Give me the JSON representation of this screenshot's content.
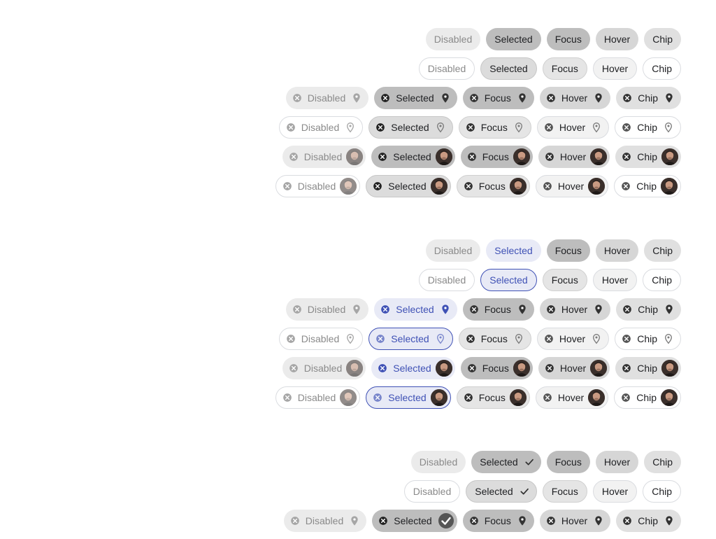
{
  "sections": [
    {
      "scheme": "default",
      "rows": [
        {
          "variant": "filled",
          "lead": false,
          "trail": "none",
          "chips": [
            {
              "state": "disabled",
              "label": "Disabled"
            },
            {
              "state": "selected",
              "label": "Selected"
            },
            {
              "state": "focus",
              "label": "Focus"
            },
            {
              "state": "hover",
              "label": "Hover"
            },
            {
              "state": "normal",
              "label": "Chip"
            }
          ]
        },
        {
          "variant": "outlined",
          "lead": false,
          "trail": "none",
          "chips": [
            {
              "state": "disabled",
              "label": "Disabled"
            },
            {
              "state": "selected",
              "label": "Selected"
            },
            {
              "state": "focus",
              "label": "Focus"
            },
            {
              "state": "hover",
              "label": "Hover"
            },
            {
              "state": "normal",
              "label": "Chip"
            }
          ]
        },
        {
          "variant": "filled",
          "lead": true,
          "trail": "location-pin-icon",
          "chips": [
            {
              "state": "disabled",
              "label": "Disabled"
            },
            {
              "state": "selected",
              "label": "Selected"
            },
            {
              "state": "focus",
              "label": "Focus"
            },
            {
              "state": "hover",
              "label": "Hover"
            },
            {
              "state": "normal",
              "label": "Chip"
            }
          ]
        },
        {
          "variant": "outlined",
          "lead": true,
          "trail": "location-pin-icon",
          "chips": [
            {
              "state": "disabled",
              "label": "Disabled"
            },
            {
              "state": "selected",
              "label": "Selected"
            },
            {
              "state": "focus",
              "label": "Focus"
            },
            {
              "state": "hover",
              "label": "Hover"
            },
            {
              "state": "normal",
              "label": "Chip"
            }
          ]
        },
        {
          "variant": "filled",
          "lead": true,
          "trail": "avatar",
          "chips": [
            {
              "state": "disabled",
              "label": "Disabled"
            },
            {
              "state": "selected",
              "label": "Selected"
            },
            {
              "state": "focus",
              "label": "Focus"
            },
            {
              "state": "hover",
              "label": "Hover"
            },
            {
              "state": "normal",
              "label": "Chip"
            }
          ]
        },
        {
          "variant": "outlined",
          "lead": true,
          "trail": "avatar",
          "chips": [
            {
              "state": "disabled",
              "label": "Disabled"
            },
            {
              "state": "selected",
              "label": "Selected"
            },
            {
              "state": "focus",
              "label": "Focus"
            },
            {
              "state": "hover",
              "label": "Hover"
            },
            {
              "state": "normal",
              "label": "Chip"
            }
          ]
        }
      ]
    },
    {
      "scheme": "secondary",
      "rows": [
        {
          "variant": "filled",
          "lead": false,
          "trail": "none",
          "chips": [
            {
              "state": "disabled",
              "label": "Disabled"
            },
            {
              "state": "selected",
              "label": "Selected"
            },
            {
              "state": "focus",
              "label": "Focus"
            },
            {
              "state": "hover",
              "label": "Hover"
            },
            {
              "state": "normal",
              "label": "Chip"
            }
          ]
        },
        {
          "variant": "outlined",
          "lead": false,
          "trail": "none",
          "chips": [
            {
              "state": "disabled",
              "label": "Disabled"
            },
            {
              "state": "selected",
              "label": "Selected"
            },
            {
              "state": "focus",
              "label": "Focus"
            },
            {
              "state": "hover",
              "label": "Hover"
            },
            {
              "state": "normal",
              "label": "Chip"
            }
          ]
        },
        {
          "variant": "filled",
          "lead": true,
          "trail": "location-pin-icon",
          "chips": [
            {
              "state": "disabled",
              "label": "Disabled"
            },
            {
              "state": "selected",
              "label": "Selected"
            },
            {
              "state": "focus",
              "label": "Focus"
            },
            {
              "state": "hover",
              "label": "Hover"
            },
            {
              "state": "normal",
              "label": "Chip"
            }
          ]
        },
        {
          "variant": "outlined",
          "lead": true,
          "trail": "location-pin-icon",
          "chips": [
            {
              "state": "disabled",
              "label": "Disabled"
            },
            {
              "state": "selected",
              "label": "Selected"
            },
            {
              "state": "focus",
              "label": "Focus"
            },
            {
              "state": "hover",
              "label": "Hover"
            },
            {
              "state": "normal",
              "label": "Chip"
            }
          ]
        },
        {
          "variant": "filled",
          "lead": true,
          "trail": "avatar",
          "chips": [
            {
              "state": "disabled",
              "label": "Disabled"
            },
            {
              "state": "selected",
              "label": "Selected"
            },
            {
              "state": "focus",
              "label": "Focus"
            },
            {
              "state": "hover",
              "label": "Hover"
            },
            {
              "state": "normal",
              "label": "Chip"
            }
          ]
        },
        {
          "variant": "outlined",
          "lead": true,
          "trail": "avatar",
          "chips": [
            {
              "state": "disabled",
              "label": "Disabled"
            },
            {
              "state": "selected",
              "label": "Selected"
            },
            {
              "state": "focus",
              "label": "Focus"
            },
            {
              "state": "hover",
              "label": "Hover"
            },
            {
              "state": "normal",
              "label": "Chip"
            }
          ]
        }
      ]
    },
    {
      "scheme": "default",
      "rows": [
        {
          "variant": "filled",
          "lead": false,
          "trail": "none",
          "chips": [
            {
              "state": "disabled",
              "label": "Disabled"
            },
            {
              "state": "selected",
              "label": "Selected",
              "check": true
            },
            {
              "state": "focus",
              "label": "Focus"
            },
            {
              "state": "hover",
              "label": "Hover"
            },
            {
              "state": "normal",
              "label": "Chip"
            }
          ]
        },
        {
          "variant": "outlined",
          "lead": false,
          "trail": "none",
          "chips": [
            {
              "state": "disabled",
              "label": "Disabled"
            },
            {
              "state": "selected",
              "label": "Selected",
              "check": true
            },
            {
              "state": "focus",
              "label": "Focus"
            },
            {
              "state": "hover",
              "label": "Hover"
            },
            {
              "state": "normal",
              "label": "Chip"
            }
          ]
        },
        {
          "variant": "filled",
          "lead": true,
          "trail": "location-pin-icon",
          "chips": [
            {
              "state": "disabled",
              "label": "Disabled"
            },
            {
              "state": "selected",
              "label": "Selected",
              "check": true
            },
            {
              "state": "focus",
              "label": "Focus"
            },
            {
              "state": "hover",
              "label": "Hover"
            },
            {
              "state": "normal",
              "label": "Chip"
            }
          ]
        }
      ]
    }
  ],
  "colors": {
    "icon": "#424242",
    "icon_disabled": "#a6a6a6",
    "secondary": "#3f51b5",
    "secondary_light": "#7986cb"
  }
}
